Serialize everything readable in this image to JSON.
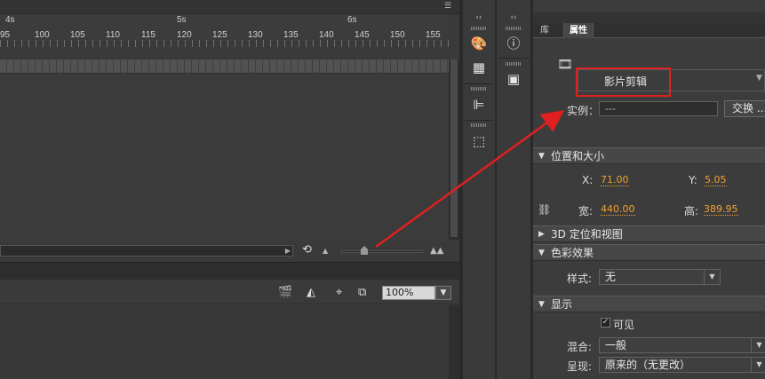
{
  "timeline": {
    "menu_icon": "panel-menu-icon",
    "seconds": [
      "4s",
      "5s",
      "6s"
    ],
    "frame_numbers": [
      "95",
      "100",
      "105",
      "110",
      "115",
      "120",
      "125",
      "130",
      "135",
      "140",
      "145",
      "150",
      "155"
    ]
  },
  "stage": {
    "zoom": "100%"
  },
  "docks": {
    "collapse_left": "‹‹",
    "collapse_right": "‹‹"
  },
  "properties": {
    "tabs": [
      "库",
      "属性"
    ],
    "symbol_type": "影片剪辑",
    "instance_label": "实例：",
    "instance_value": "---",
    "swap_button": "交换 ...",
    "sections": {
      "position": "位置和大小",
      "pos3d": "3D 定位和视图",
      "color": "色彩效果",
      "display": "显示"
    },
    "position": {
      "x_label": "X:",
      "x_value": "71.00",
      "y_label": "Y:",
      "y_value": "5.05",
      "w_label": "宽:",
      "w_value": "440.00",
      "h_label": "高:",
      "h_value": "389.95"
    },
    "color": {
      "style_label": "样式:",
      "style_value": "无"
    },
    "display": {
      "visible_label": "可见",
      "blend_label": "混合:",
      "blend_value": "一般",
      "render_label": "呈现:",
      "render_value": "原来的（无更改）"
    }
  },
  "annotation": {
    "highlight_color": "#e02020"
  }
}
